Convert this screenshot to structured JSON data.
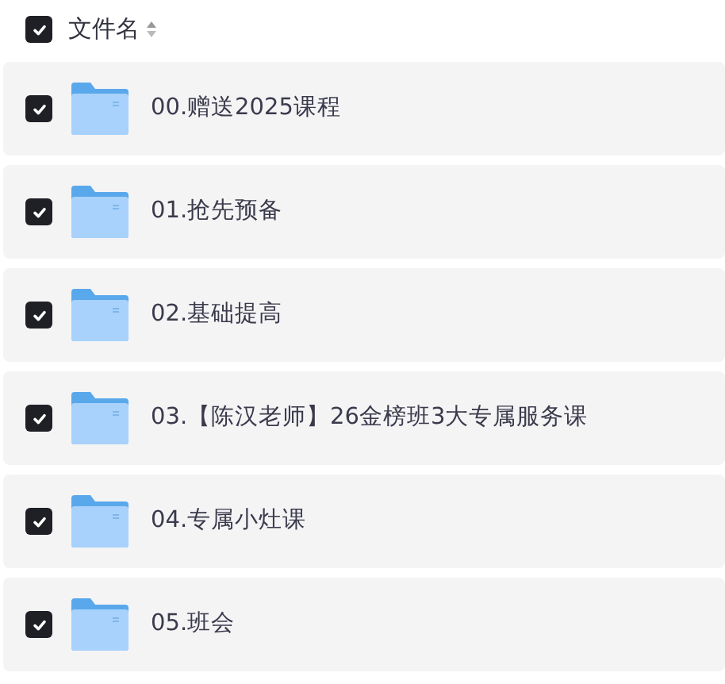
{
  "header": {
    "label": "文件名",
    "checked": true
  },
  "rows": [
    {
      "name": "00.赠送2025课程",
      "checked": true
    },
    {
      "name": "01.抢先预备",
      "checked": true
    },
    {
      "name": "02.基础提高",
      "checked": true
    },
    {
      "name": "03.【陈汉老师】26金榜班3大专属服务课",
      "checked": true
    },
    {
      "name": "04.专属小灶课",
      "checked": true
    },
    {
      "name": "05.班会",
      "checked": true
    }
  ]
}
